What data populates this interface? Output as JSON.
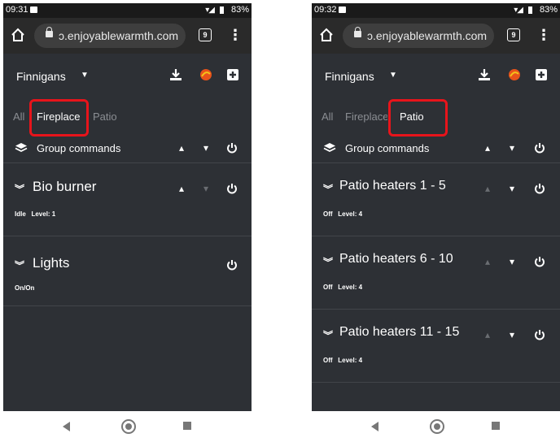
{
  "screens": [
    {
      "time": "09:31",
      "battery": "83%",
      "url": "ɔ.enjoyablewarmth.com",
      "tab_count": "9",
      "site_name": "Finnigans",
      "tabs": [
        "All",
        "Fireplace",
        "Patio"
      ],
      "active_tab": "Fireplace",
      "group_commands": "Group commands",
      "groups": [
        {
          "title": "Bio burner",
          "status": "Idle",
          "level": "Level: 1"
        },
        {
          "title": "Lights",
          "status": "On/On"
        }
      ]
    },
    {
      "time": "09:32",
      "battery": "83%",
      "url": "ɔ.enjoyablewarmth.com",
      "tab_count": "9",
      "site_name": "Finnigans",
      "tabs": [
        "All",
        "Fireplace",
        "Patio"
      ],
      "active_tab": "Patio",
      "group_commands": "Group commands",
      "groups": [
        {
          "title": "Patio heaters 1 - 5",
          "status": "Off",
          "level": "Level: 4"
        },
        {
          "title": "Patio heaters 6 - 10",
          "status": "Off",
          "level": "Level: 4"
        },
        {
          "title": "Patio heaters 11 - 15",
          "status": "Off",
          "level": "Level: 4"
        }
      ]
    }
  ],
  "icons": {
    "chevron_up": "▴",
    "chevron_down": "▾",
    "power": "power-icon",
    "expand": "double-chevron-down-icon",
    "layers": "layers-icon",
    "download": "download-icon",
    "weather": "weather-icon",
    "add": "add-icon"
  },
  "colors": {
    "app_background": "#2d3035",
    "highlight_box": "#e8141b",
    "active_tab": "#ffffff",
    "inactive_tab": "#8b8e93"
  }
}
